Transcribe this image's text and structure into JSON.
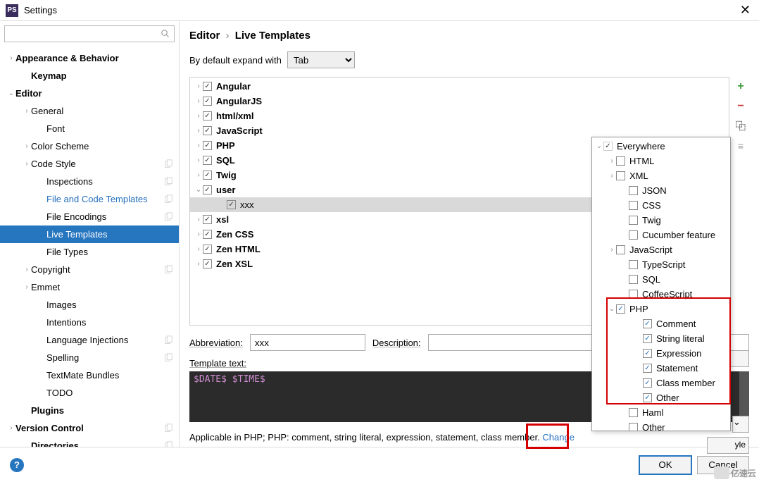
{
  "window": {
    "title": "Settings",
    "close": "✕"
  },
  "search": {
    "placeholder": ""
  },
  "nav": [
    {
      "label": "Appearance & Behavior",
      "bold": true,
      "depth": 0,
      "chev": "›",
      "copy": false
    },
    {
      "label": "Keymap",
      "bold": true,
      "depth": 1,
      "chev": "",
      "copy": false
    },
    {
      "label": "Editor",
      "bold": true,
      "depth": 0,
      "chev": "⌄",
      "copy": false
    },
    {
      "label": "General",
      "bold": false,
      "depth": 1,
      "chev": "›",
      "copy": false
    },
    {
      "label": "Font",
      "bold": false,
      "depth": 2,
      "chev": "",
      "copy": false
    },
    {
      "label": "Color Scheme",
      "bold": false,
      "depth": 1,
      "chev": "›",
      "copy": false
    },
    {
      "label": "Code Style",
      "bold": false,
      "depth": 1,
      "chev": "›",
      "copy": true
    },
    {
      "label": "Inspections",
      "bold": false,
      "depth": 2,
      "chev": "",
      "copy": true
    },
    {
      "label": "File and Code Templates",
      "bold": false,
      "depth": 2,
      "chev": "",
      "copy": true,
      "link": true
    },
    {
      "label": "File Encodings",
      "bold": false,
      "depth": 2,
      "chev": "",
      "copy": true
    },
    {
      "label": "Live Templates",
      "bold": false,
      "depth": 2,
      "chev": "",
      "copy": false,
      "selected": true
    },
    {
      "label": "File Types",
      "bold": false,
      "depth": 2,
      "chev": "",
      "copy": false
    },
    {
      "label": "Copyright",
      "bold": false,
      "depth": 1,
      "chev": "›",
      "copy": true
    },
    {
      "label": "Emmet",
      "bold": false,
      "depth": 1,
      "chev": "›",
      "copy": false
    },
    {
      "label": "Images",
      "bold": false,
      "depth": 2,
      "chev": "",
      "copy": false
    },
    {
      "label": "Intentions",
      "bold": false,
      "depth": 2,
      "chev": "",
      "copy": false
    },
    {
      "label": "Language Injections",
      "bold": false,
      "depth": 2,
      "chev": "",
      "copy": true
    },
    {
      "label": "Spelling",
      "bold": false,
      "depth": 2,
      "chev": "",
      "copy": true
    },
    {
      "label": "TextMate Bundles",
      "bold": false,
      "depth": 2,
      "chev": "",
      "copy": false
    },
    {
      "label": "TODO",
      "bold": false,
      "depth": 2,
      "chev": "",
      "copy": false
    },
    {
      "label": "Plugins",
      "bold": true,
      "depth": 1,
      "chev": "",
      "copy": false
    },
    {
      "label": "Version Control",
      "bold": true,
      "depth": 0,
      "chev": "›",
      "copy": true
    },
    {
      "label": "Directories",
      "bold": true,
      "depth": 1,
      "chev": "",
      "copy": true
    }
  ],
  "breadcrumb": {
    "a": "Editor",
    "b": "Live Templates",
    "sep": "›"
  },
  "expand": {
    "label": "By default expand with",
    "value": "Tab"
  },
  "tree": [
    {
      "label": "Angular",
      "chev": "›",
      "depth": 1,
      "bold": true,
      "checked": true
    },
    {
      "label": "AngularJS",
      "chev": "›",
      "depth": 1,
      "bold": true,
      "checked": true
    },
    {
      "label": "html/xml",
      "chev": "›",
      "depth": 1,
      "bold": true,
      "checked": true
    },
    {
      "label": "JavaScript",
      "chev": "›",
      "depth": 1,
      "bold": true,
      "checked": true
    },
    {
      "label": "PHP",
      "chev": "›",
      "depth": 1,
      "bold": true,
      "checked": true
    },
    {
      "label": "SQL",
      "chev": "›",
      "depth": 1,
      "bold": true,
      "checked": true
    },
    {
      "label": "Twig",
      "chev": "›",
      "depth": 1,
      "bold": true,
      "checked": true
    },
    {
      "label": "user",
      "chev": "⌄",
      "depth": 1,
      "bold": true,
      "checked": true
    },
    {
      "label": "xxx",
      "chev": "",
      "depth": 2,
      "bold": false,
      "checked": true,
      "selected": true
    },
    {
      "label": "xsl",
      "chev": "›",
      "depth": 1,
      "bold": true,
      "checked": true
    },
    {
      "label": "Zen CSS",
      "chev": "›",
      "depth": 1,
      "bold": true,
      "checked": true
    },
    {
      "label": "Zen HTML",
      "chev": "›",
      "depth": 1,
      "bold": true,
      "checked": true
    },
    {
      "label": "Zen XSL",
      "chev": "›",
      "depth": 1,
      "bold": true,
      "checked": true
    }
  ],
  "tools": {
    "add": "+",
    "remove": "−",
    "copy": "⿻",
    "other": "≡"
  },
  "form": {
    "abbr_label": "Abbreviation:",
    "abbr_value": "xxx",
    "desc_label": "Description:",
    "desc_value": "",
    "tmpl_label": "Template text:",
    "tmpl_value": "$DATE$ $TIME$"
  },
  "applicable": {
    "text_a": "Applicable in PHP; PHP: comment, string literal, expression, statement, class member. ",
    "change": "Change"
  },
  "context": [
    {
      "label": "Everywhere",
      "depth": 0,
      "chev": "⌄",
      "checked": true,
      "disabled": true
    },
    {
      "label": "HTML",
      "depth": 1,
      "chev": "›",
      "checked": false
    },
    {
      "label": "XML",
      "depth": 1,
      "chev": "›",
      "checked": false
    },
    {
      "label": "JSON",
      "depth": 2,
      "chev": "",
      "checked": false
    },
    {
      "label": "CSS",
      "depth": 2,
      "chev": "",
      "checked": false
    },
    {
      "label": "Twig",
      "depth": 2,
      "chev": "",
      "checked": false
    },
    {
      "label": "Cucumber feature",
      "depth": 2,
      "chev": "",
      "checked": false
    },
    {
      "label": "JavaScript",
      "depth": 1,
      "chev": "›",
      "checked": false
    },
    {
      "label": "TypeScript",
      "depth": 2,
      "chev": "",
      "checked": false
    },
    {
      "label": "SQL",
      "depth": 2,
      "chev": "",
      "checked": false
    },
    {
      "label": "CoffeeScript",
      "depth": 2,
      "chev": "",
      "checked": false
    },
    {
      "label": "PHP",
      "depth": 1,
      "chev": "⌄",
      "checked": true,
      "blue": true
    },
    {
      "label": "Comment",
      "depth": 3,
      "chev": "",
      "checked": true,
      "blue": true
    },
    {
      "label": "String literal",
      "depth": 3,
      "chev": "",
      "checked": true,
      "blue": true
    },
    {
      "label": "Expression",
      "depth": 3,
      "chev": "",
      "checked": true,
      "blue": true
    },
    {
      "label": "Statement",
      "depth": 3,
      "chev": "",
      "checked": true,
      "blue": true
    },
    {
      "label": "Class member",
      "depth": 3,
      "chev": "",
      "checked": true,
      "blue": true
    },
    {
      "label": "Other",
      "depth": 3,
      "chev": "",
      "checked": true,
      "blue": true
    },
    {
      "label": "Haml",
      "depth": 2,
      "chev": "",
      "checked": false
    },
    {
      "label": "Other",
      "depth": 2,
      "chev": "",
      "checked": false
    }
  ],
  "ghost": {
    "style_suffix": "yle"
  },
  "footer": {
    "ok": "OK",
    "cancel": "Cancel",
    "help": "?"
  },
  "watermark": "亿速云"
}
